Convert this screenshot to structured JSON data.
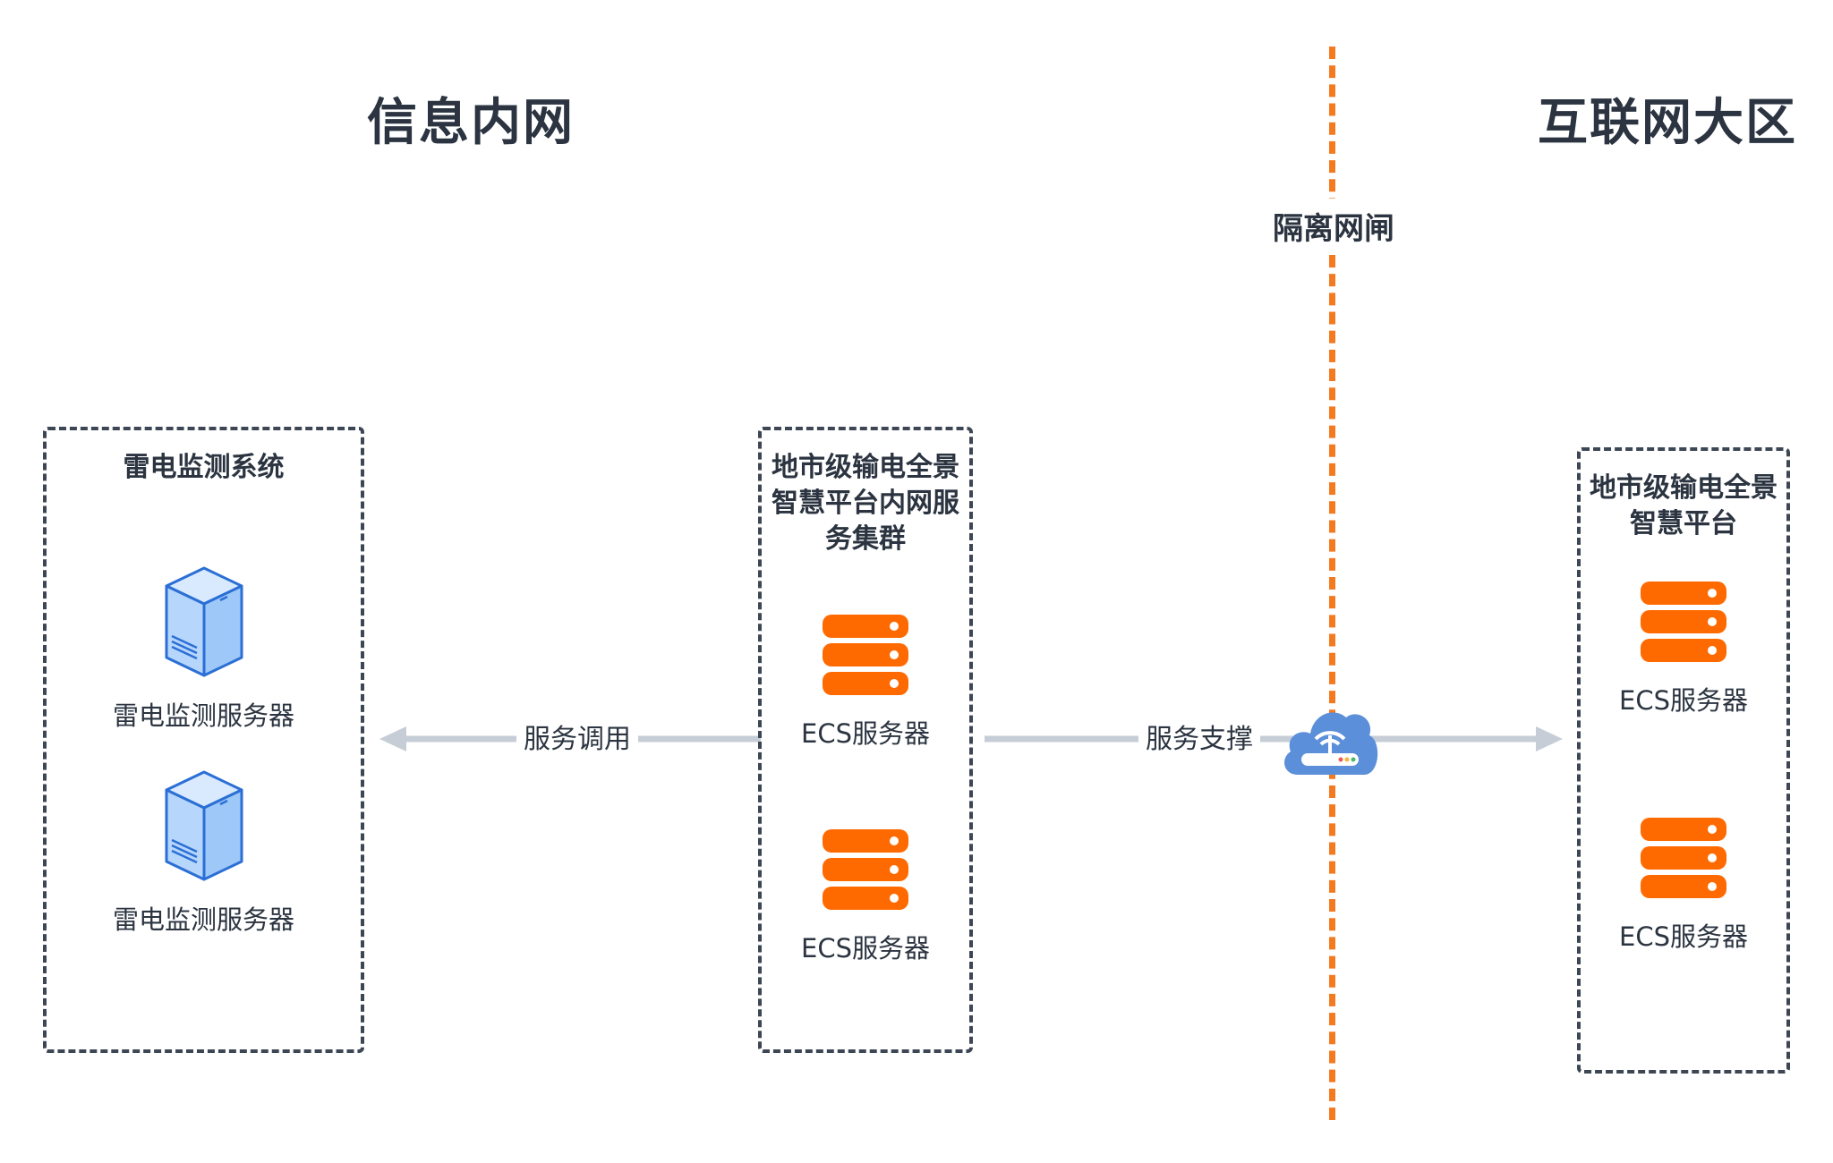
{
  "zones": {
    "left": "信息内网",
    "right": "互联网大区",
    "gap": "隔离网闸"
  },
  "groups": {
    "left": {
      "title": "雷电监测系统",
      "nodes": [
        {
          "label": "雷电监测服务器",
          "icon": "tower-server-icon"
        },
        {
          "label": "雷电监测服务器",
          "icon": "tower-server-icon"
        }
      ]
    },
    "middle": {
      "title": "地市级输电全景智慧平台内网服务集群",
      "nodes": [
        {
          "label": "ECS服务器",
          "icon": "rack-server-icon"
        },
        {
          "label": "ECS服务器",
          "icon": "rack-server-icon"
        }
      ]
    },
    "right": {
      "title": "地市级输电全景智慧平台",
      "nodes": [
        {
          "label": "ECS服务器",
          "icon": "rack-server-icon"
        },
        {
          "label": "ECS服务器",
          "icon": "rack-server-icon"
        }
      ]
    }
  },
  "edges": [
    {
      "label": "服务调用",
      "from": "middle",
      "to": "left"
    },
    {
      "label": "服务支撑",
      "from": "middle",
      "to": "right"
    }
  ],
  "colors": {
    "server_orange": "#ff6a00",
    "tower_blue": "#2b6fd6",
    "tower_fill": "#b7d6fb",
    "divider_orange": "#f47a20",
    "arrow_gray": "#c6cdd6",
    "text_dark": "#2b3440",
    "gateway_blue": "#5b8fd9"
  }
}
